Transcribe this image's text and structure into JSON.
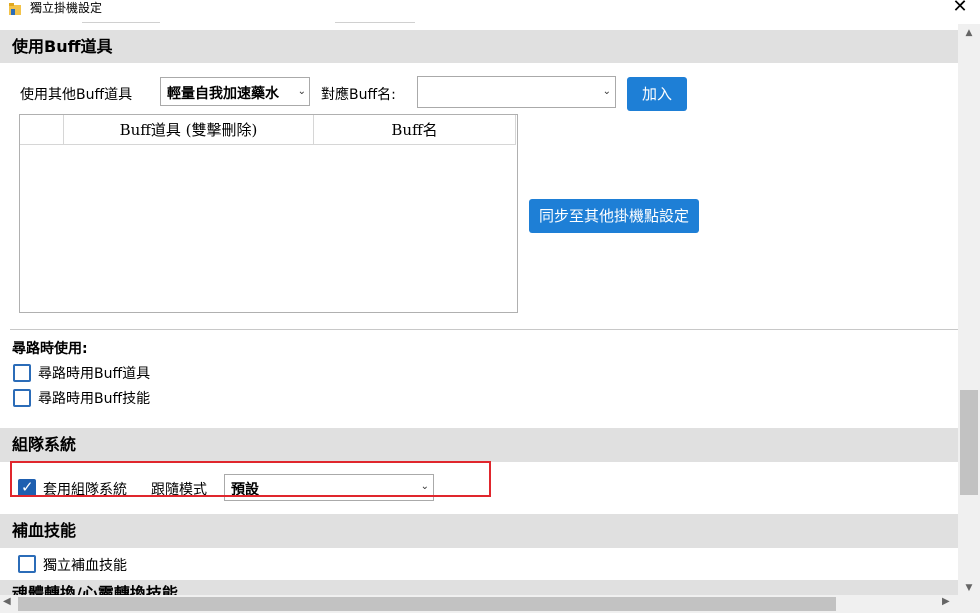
{
  "window": {
    "title": "獨立掛機設定",
    "close_glyph": "✕"
  },
  "buff_section": {
    "header": "使用Buff道具",
    "use_other_label": "使用其他Buff道具",
    "item_combo_value": "輕量自我加速藥水",
    "buff_name_label": "對應Buff名:",
    "buff_name_value": "",
    "add_button": "加入",
    "columns": [
      "Buff道具 (雙擊刪除)",
      "Buff名"
    ],
    "sync_button": "同步至其他掛機點設定"
  },
  "pathing_section": {
    "title": "尋路時使用:",
    "options": [
      {
        "label": "尋路時用Buff道具",
        "checked": false
      },
      {
        "label": "尋路時用Buff技能",
        "checked": false
      }
    ]
  },
  "team_section": {
    "header": "組隊系統",
    "apply_label": "套用組隊系統",
    "apply_checked": true,
    "follow_mode_label": "跟隨模式",
    "follow_mode_value": "預設"
  },
  "heal_section": {
    "header": "補血技能",
    "independent_label": "獨立補血技能",
    "independent_checked": false
  },
  "next_section": {
    "header_partial": "魂體轉換/心靈轉換技能"
  },
  "icons": {
    "app": "folder-icon",
    "chevron": "chevron-down-icon",
    "check": "checkmark-icon"
  },
  "colors": {
    "accent_blue": "#1e7fd6",
    "section_bg": "#e0e0e0",
    "highlight_red": "#e0262d"
  }
}
